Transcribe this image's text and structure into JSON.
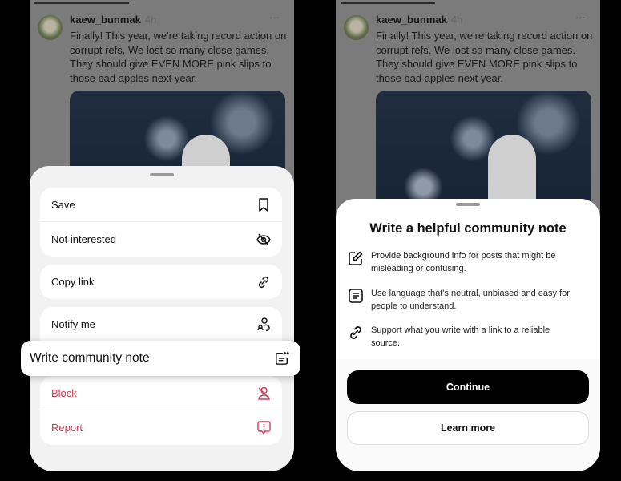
{
  "post": {
    "username": "kaew_bunmak",
    "time": "4h",
    "more_icon": "ellipsis-icon",
    "text": "Finally! This year, we're taking record action on corrupt refs. We lost so many close games. They should give EVEN MORE pink slips to those bad apples next year."
  },
  "menu": {
    "groups": [
      [
        {
          "label": "Save",
          "icon": "bookmark-icon"
        },
        {
          "label": "Not interested",
          "icon": "eye-off-icon"
        }
      ],
      [
        {
          "label": "Copy link",
          "icon": "link-icon"
        }
      ],
      [
        {
          "label": "Notify me",
          "icon": "people-icon"
        }
      ],
      [
        {
          "label": "Block",
          "icon": "user-off-icon"
        },
        {
          "label": "Report",
          "icon": "report-icon"
        }
      ]
    ],
    "highlight": {
      "label": "Write community note",
      "icon": "community-note-icon"
    },
    "danger_color": "#d23a55"
  },
  "note_sheet": {
    "title": "Write a helpful community note",
    "rules": [
      {
        "icon": "pencil-icon",
        "text": "Provide background info for posts that might be misleading or confusing."
      },
      {
        "icon": "document-icon",
        "text": "Use language that's neutral, unbiased and easy for people to understand."
      },
      {
        "icon": "link-icon",
        "text": "Support what you write with a link to a reliable source."
      }
    ],
    "continue_label": "Continue",
    "learn_more_label": "Learn more"
  }
}
